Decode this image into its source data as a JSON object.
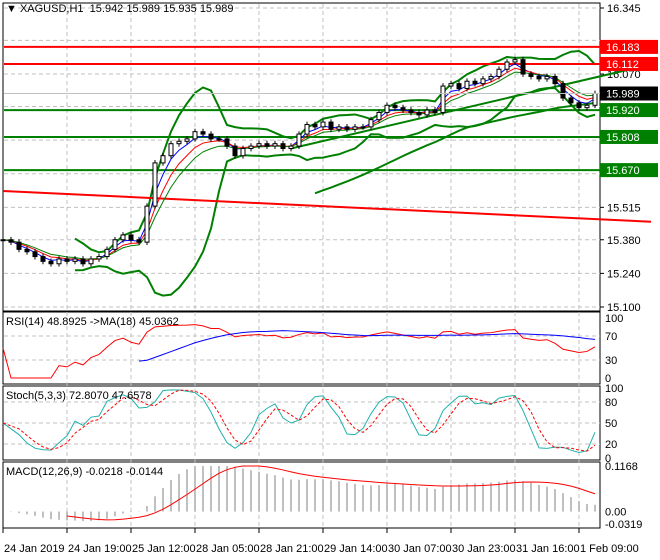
{
  "chart_data": {
    "type": "candlestick",
    "title": "XAGUSD,H1",
    "ohlc_readout": [
      "15.942",
      "15.989",
      "15.935",
      "15.989"
    ],
    "price_ticks": [
      "16.345",
      "16.070",
      "15.515",
      "15.380",
      "15.240",
      "15.100"
    ],
    "ylim": [
      15.1,
      16.345
    ],
    "time_labels": [
      "24 Jan 2019",
      "24 Jan 19:00",
      "25 Jan 12:00",
      "28 Jan 05:00",
      "28 Jan 21:00",
      "29 Jan 14:00",
      "30 Jan 07:00",
      "30 Jan 23:00",
      "31 Jan 16:00",
      "1 Feb 09:00"
    ],
    "closes": [
      15.38,
      15.37,
      15.34,
      15.33,
      15.31,
      15.29,
      15.28,
      15.3,
      15.29,
      15.3,
      15.28,
      15.3,
      15.31,
      15.34,
      15.38,
      15.4,
      15.38,
      15.37,
      15.52,
      15.7,
      15.73,
      15.78,
      15.79,
      15.8,
      15.83,
      15.82,
      15.8,
      15.8,
      15.77,
      15.73,
      15.76,
      15.77,
      15.78,
      15.77,
      15.78,
      15.76,
      15.77,
      15.82,
      15.86,
      15.85,
      15.87,
      15.84,
      15.85,
      15.84,
      15.85,
      15.85,
      15.88,
      15.91,
      15.94,
      15.93,
      15.92,
      15.91,
      15.9,
      15.92,
      15.91,
      16.02,
      16.03,
      16.01,
      16.04,
      16.03,
      16.05,
      16.06,
      16.09,
      16.12,
      16.13,
      16.07,
      16.06,
      16.05,
      16.06,
      16.03,
      15.97,
      15.95,
      15.93,
      15.94,
      15.989
    ],
    "levels": [
      {
        "price": "16.183",
        "color": "#ff0000"
      },
      {
        "price": "16.112",
        "color": "#ff0000"
      },
      {
        "price": "15.920",
        "color": "#008000"
      },
      {
        "price": "15.808",
        "color": "#008000"
      },
      {
        "price": "15.670",
        "color": "#008000"
      }
    ],
    "current_price": "15.989",
    "trendlines": [
      {
        "from": [
          0,
          15.583
        ],
        "to": [
          81,
          15.455
        ],
        "color": "#ff0000"
      },
      {
        "from": [
          36,
          15.76
        ],
        "to": [
          81,
          16.11
        ],
        "color": "#008000"
      }
    ],
    "bollinger_color": "#008000",
    "ma_colors": [
      "#0000ff",
      "#ff0000",
      "#008000"
    ],
    "indicators": {
      "rsi": {
        "label": "RSI(14) 48.8925  ->MA(18) 45.0362",
        "ticks": [
          "100",
          "70",
          "30",
          "0"
        ],
        "colors": [
          "#ff0000",
          "#0000ff"
        ]
      },
      "stoch": {
        "label": "Stoch(5,3,3) 72.8070 47.6578",
        "ticks": [
          "100",
          "80",
          "50",
          "20",
          "0"
        ],
        "colors": [
          "#20b2aa",
          "#ff0000"
        ]
      },
      "macd": {
        "label": "MACD(12,26,9) -0.0218 -0.0144",
        "ticks": [
          "0.1168",
          "0.00",
          "-0.0319"
        ],
        "colors": [
          "#c0c0c0",
          "#ff0000"
        ]
      }
    }
  }
}
